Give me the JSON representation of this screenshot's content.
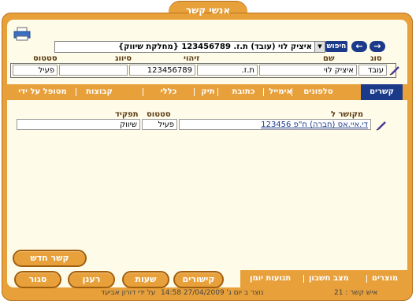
{
  "window": {
    "title": "אנשי קשר"
  },
  "search": {
    "button_label": "חיפוש",
    "combo_value": "איציק לוי (עובד) ת.ז. 123456789 {מחלקת שיווק}",
    "prev_arrow": "←",
    "next_arrow": "→"
  },
  "details": {
    "headers": {
      "type": "סוג",
      "name": "שם",
      "id": "זיהוי",
      "tag": "סיווג",
      "status": "סטטוס"
    },
    "values": {
      "type": "עובד",
      "name": "איציק לוי",
      "id_type": "ת.ז.",
      "id_number": "123456789",
      "tag": "",
      "status": "פעיל"
    }
  },
  "tabs": [
    {
      "label": "קשרים",
      "active": true
    },
    {
      "label": "טלפונים",
      "active": false
    },
    {
      "label": "אימייל",
      "active": false
    },
    {
      "label": "כתובת",
      "active": false
    },
    {
      "label": "תיק",
      "active": false
    },
    {
      "label": "כללי",
      "active": false
    },
    {
      "label": "קבוצות",
      "active": false
    },
    {
      "label": "מטופל על ידי",
      "active": false
    }
  ],
  "relations": {
    "headers": {
      "related_to": "מקושר ל",
      "status": "סטטוס",
      "role": "תפקיד"
    },
    "rows": [
      {
        "related_to": "די.איי.אס (חברה) ח\"פ 123456",
        "status": "פעיל",
        "role": "שיווק"
      }
    ]
  },
  "buttons": {
    "new_contact": "קשר חדש",
    "relations": "קישורים",
    "hours": "שעות",
    "refresh": "רענן",
    "close": "סגור"
  },
  "bottom_links": [
    "מוצרים",
    "מצב חשבון",
    "תנועות יומן"
  ],
  "footer": {
    "contact_number": "איש קשר : 21",
    "created": "נוצר ב יום ג' 27/04/2009 14:58",
    "created_by": "על ידי דורון אביעד"
  },
  "colors": {
    "frame": "#e8a03a",
    "accent": "#1b3a8a",
    "panel": "#fffbe9"
  }
}
